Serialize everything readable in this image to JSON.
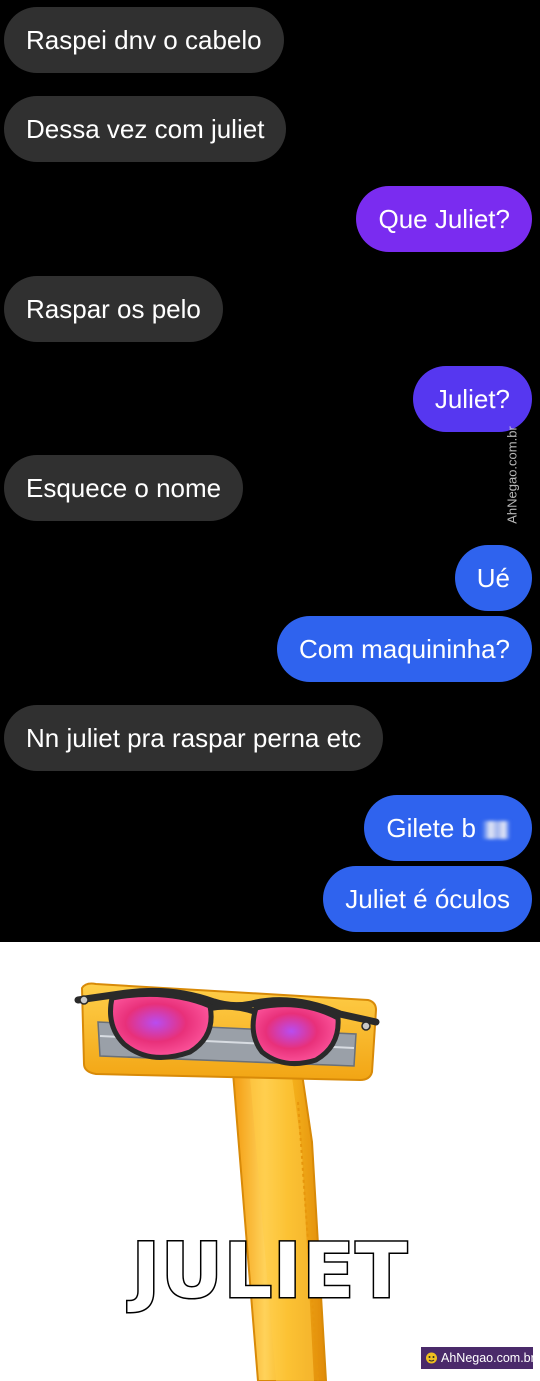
{
  "conversation": {
    "messages": [
      {
        "side": "received",
        "text": "Raspei dnv o cabelo"
      },
      {
        "side": "received",
        "text": "Dessa vez com juliet"
      },
      {
        "side": "sent",
        "text": "Que Juliet?"
      },
      {
        "side": "received",
        "text": "Raspar os pelo"
      },
      {
        "side": "sent",
        "text": "Juliet?"
      },
      {
        "side": "received",
        "text": "Esquece o nome"
      },
      {
        "side": "sent",
        "text": "Ué"
      },
      {
        "side": "sent",
        "text": "Com maquininha?"
      },
      {
        "side": "received",
        "text": "Nn juliet pra raspar perna etc"
      },
      {
        "side": "sent",
        "text": "Gilete b"
      },
      {
        "side": "sent",
        "text": "Juliet é óculos"
      }
    ]
  },
  "watermark": {
    "side_text": "AhNegao.com.br",
    "corner_text": "AhNegao.com.br"
  },
  "meme": {
    "caption": "JULIET",
    "image_subject": "yellow disposable razor wearing dark sunglasses with red-pink lenses"
  },
  "colors": {
    "chat_background": "#000000",
    "received_bubble": "#303030",
    "sent_bubble_top": "#7a2cf0",
    "sent_bubble_bottom": "#2f63ee",
    "razor_yellow": "#f7b51e",
    "lens_pink": "#e8307a"
  }
}
